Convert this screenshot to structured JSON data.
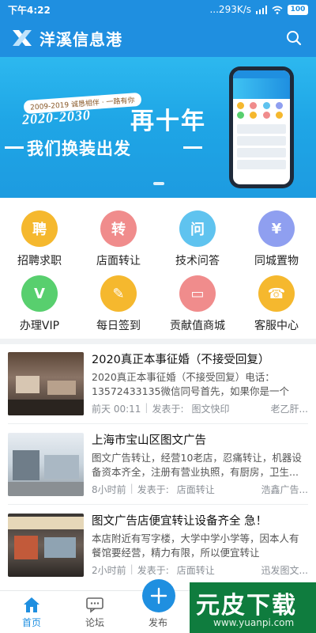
{
  "status": {
    "time": "下午4:22",
    "network": "...293K/s",
    "battery": "100"
  },
  "header": {
    "title": "洋溪信息港",
    "brand_color": "#1f8fe0"
  },
  "banner": {
    "tag": "2009-2019 诚恳相伴 · 一路有你",
    "years": "2020-2030",
    "headline": "再十年",
    "slogan": "我们换装出发"
  },
  "categories": [
    {
      "label": "招聘求职",
      "glyph": "聘",
      "color": "#f5b82e",
      "icon": "recruit-icon"
    },
    {
      "label": "店面转让",
      "glyph": "转",
      "color": "#f08c8c",
      "icon": "shop-transfer-icon"
    },
    {
      "label": "技术问答",
      "glyph": "问",
      "color": "#5fc3ef",
      "icon": "qa-icon"
    },
    {
      "label": "同城置物",
      "glyph": "¥",
      "color": "#8f9ff0",
      "icon": "local-goods-icon"
    },
    {
      "label": "办理VIP",
      "glyph": "V",
      "color": "#58cf6e",
      "icon": "vip-icon"
    },
    {
      "label": "每日签到",
      "glyph": "✎",
      "color": "#f5b82e",
      "icon": "checkin-icon"
    },
    {
      "label": "贡献值商城",
      "glyph": "▭",
      "color": "#f08c8c",
      "icon": "points-mall-icon"
    },
    {
      "label": "客服中心",
      "glyph": "☎",
      "color": "#f5b82e",
      "icon": "customer-service-icon"
    }
  ],
  "news": [
    {
      "title": "2020真正本事征婚（不接受回复）",
      "desc": "2020真正本事征婚（不接受回复）电话：13572433135微信同号首先，如果你是一个浮...",
      "time": "前天 00:11",
      "posted_label": "发表于:",
      "section": "图文快印",
      "author": "老乙肝..."
    },
    {
      "title": "上海市宝山区图文广告",
      "desc": "图文广告转让，经营10老店，忍痛转让，机器设备资本齐全，注册有营业执照，有厨房，卫生...",
      "time": "8小时前",
      "posted_label": "发表于:",
      "section": "店面转让",
      "author": "浩鑫广告..."
    },
    {
      "title": "图文广告店便宜转让设备齐全 急！",
      "desc": "本店附近有写字楼，大学中学小学等，因本人有餐馆要经营，精力有限，所以便宜转让",
      "time": "2小时前",
      "posted_label": "发表于:",
      "section": "店面转让",
      "author": "迅发图文..."
    }
  ],
  "bottom_nav": {
    "home": "首页",
    "forum": "论坛",
    "publish": "发布"
  },
  "watermark": {
    "name": "元皮下载",
    "url": "www.yuanpi.com"
  }
}
